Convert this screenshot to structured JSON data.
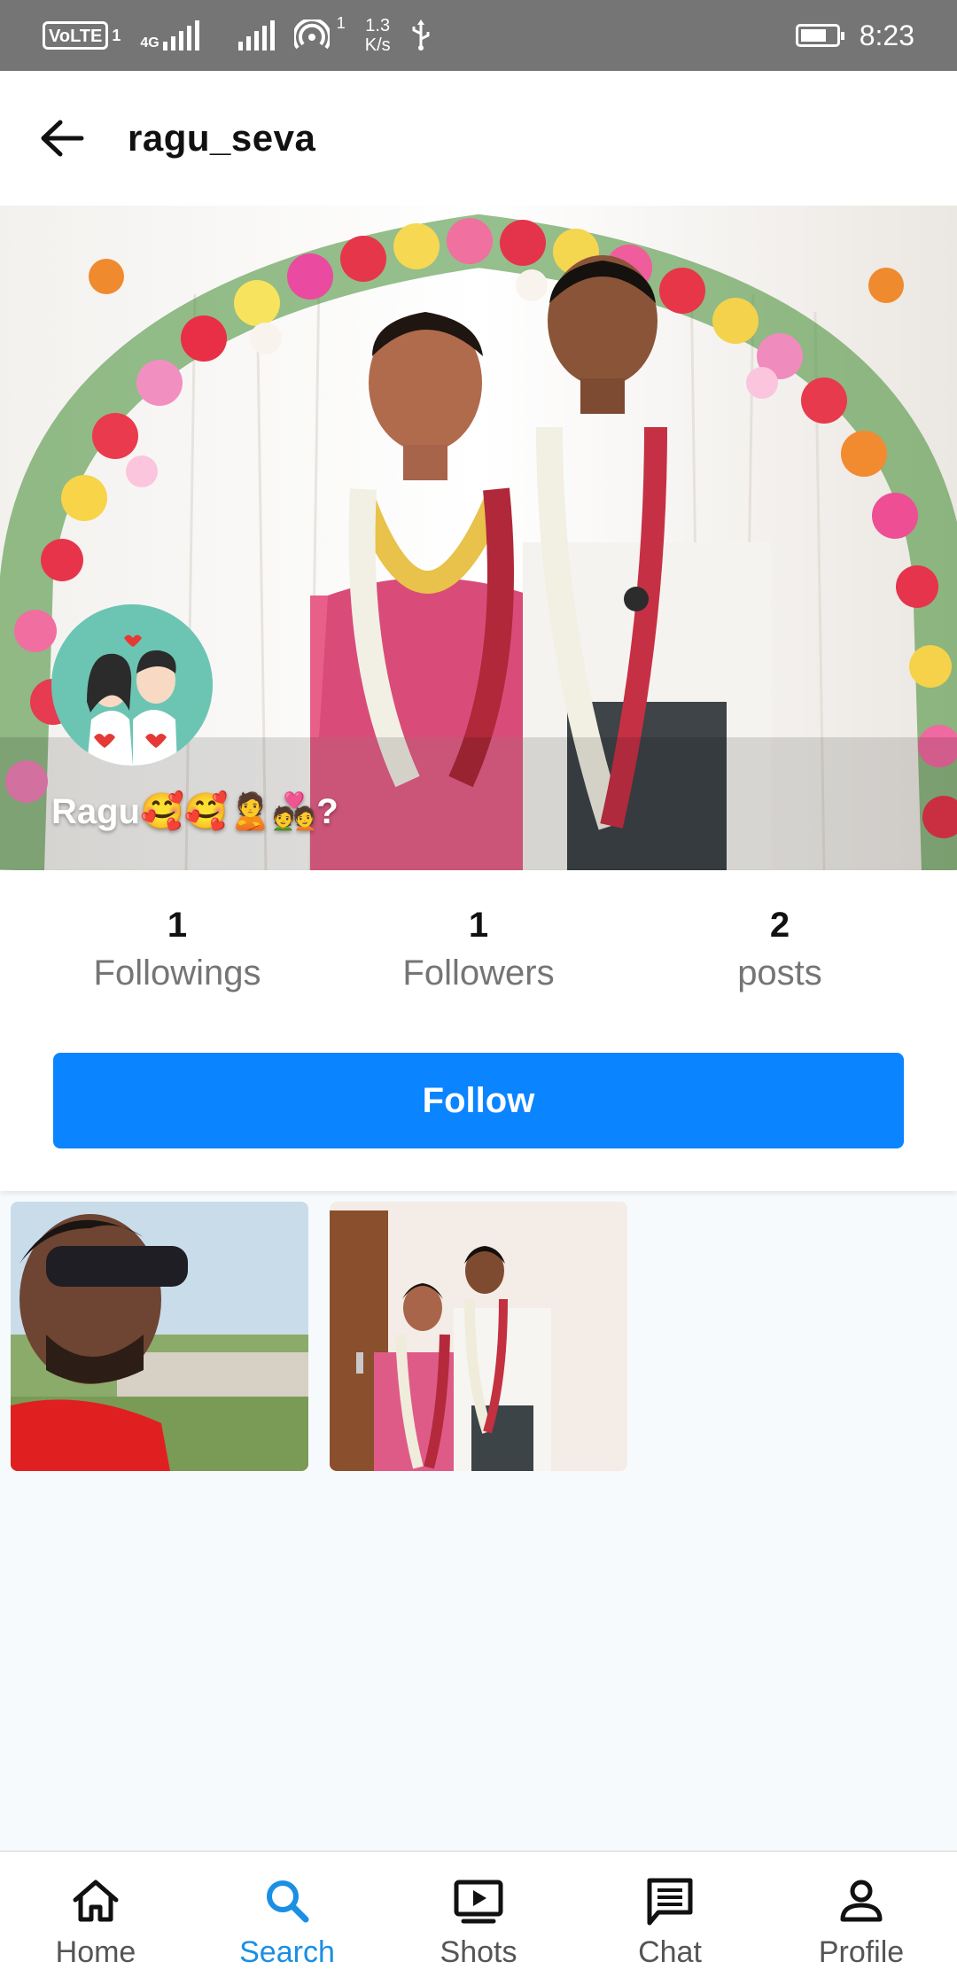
{
  "status_bar": {
    "volte": "VoLTE",
    "sim_slot": "1",
    "network_tag": "4G",
    "wifi_badge": "1",
    "speed_value": "1.3",
    "speed_unit": "K/s",
    "time": "8:23",
    "icons": [
      "volte-icon",
      "signal-icon",
      "signal-icon",
      "wifi-icon",
      "usb-icon",
      "battery-icon"
    ]
  },
  "header": {
    "title": "ragu_seva",
    "back_icon": "arrow-left-icon"
  },
  "profile": {
    "display_name": "Ragu🥰🥰🙎💑?",
    "avatar_icon": "couple-illustration"
  },
  "stats": {
    "followings": {
      "value": "1",
      "label": "Followings"
    },
    "followers": {
      "value": "1",
      "label": "Followers"
    },
    "posts": {
      "value": "2",
      "label": "posts"
    }
  },
  "actions": {
    "follow_label": "Follow"
  },
  "posts": [
    {
      "kind": "photo",
      "description_icon": "selfie-photo"
    },
    {
      "kind": "photo",
      "description_icon": "couple-photo"
    }
  ],
  "nav": {
    "items": [
      {
        "label": "Home",
        "icon": "home-icon",
        "active": false
      },
      {
        "label": "Search",
        "icon": "search-icon",
        "active": true
      },
      {
        "label": "Shots",
        "icon": "play-screen-icon",
        "active": false
      },
      {
        "label": "Chat",
        "icon": "chat-icon",
        "active": false
      },
      {
        "label": "Profile",
        "icon": "person-icon",
        "active": false
      }
    ]
  },
  "colors": {
    "accent": "#0a84ff",
    "nav_active": "#1a8fe3",
    "status_bar": "#757575"
  }
}
